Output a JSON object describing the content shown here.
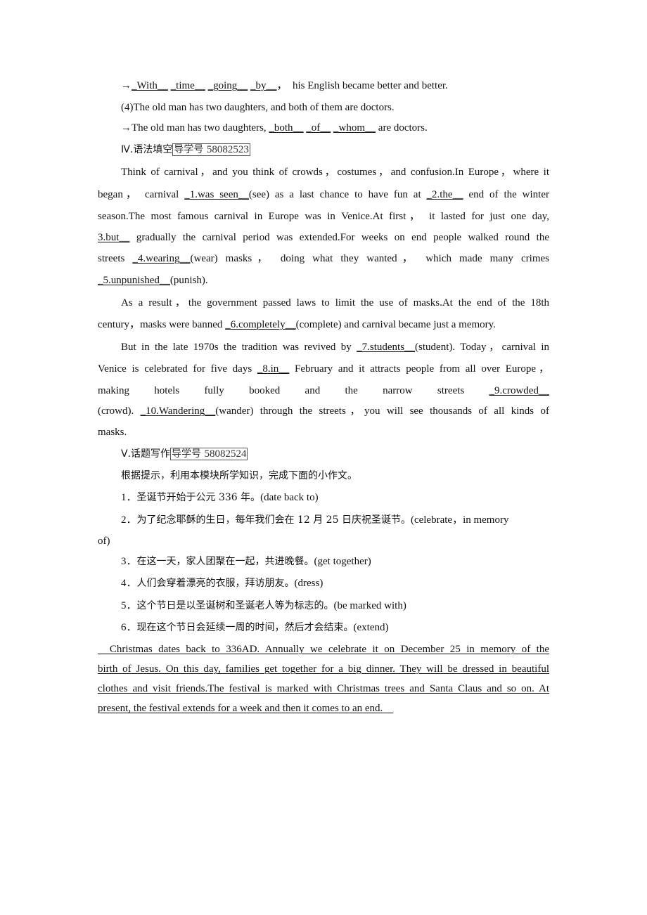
{
  "section3": {
    "line1": {
      "arrow": "→",
      "blanks": [
        "With",
        "time",
        "going",
        "by"
      ],
      "sep": "，",
      "rest": "his English became better and better."
    },
    "q4": "(4)The old man has two daughters, and both of them are doctors.",
    "line4": {
      "arrow": "→",
      "prefix": "The old man has two daughters,",
      "blanks": [
        "both",
        "of",
        "whom"
      ],
      "rest": "are doctors."
    }
  },
  "section4": {
    "heading": "Ⅳ.语法填空",
    "guide_label": "导学号",
    "guide_number": "58082523",
    "p1": {
      "l1": "Think of carnival，and you think of crowds，costumes，and confusion.In Europe，where it",
      "l2a": "began， carnival ",
      "b1": "1.was seen",
      "l2b": "(see) as a last chance to have fun at ",
      "b2": "2.the",
      "l2c": " end of the winter",
      "l3": "season.The most famous carnival in Europe was in Venice.At first， it lasted for just one day,",
      "b3": "3.but",
      "l4": " gradually the carnival period was extended.For weeks on end people walked round the",
      "l5a": "streets ",
      "b4": "4.wearing",
      "l5b": "(wear) masks， doing what they wanted， which made many crimes",
      "b5": "5.unpunished",
      "l6": "(punish)."
    },
    "p2": {
      "l1": "As a result，the government passed laws to limit the use of masks.At the end of the 18th",
      "l2a": "century，masks were banned ",
      "b6": "6.completely",
      "l2b": "(complete) and carnival became just a memory."
    },
    "p3": {
      "l1a": "But in the late 1970s the tradition was revived by ",
      "b7": "7.students",
      "l1b": "(student). Today，carnival in",
      "l2a": "Venice is celebrated for five days ",
      "b8": "8.in",
      "l2b": " February and it attracts people from all over Europe，",
      "l3words": [
        "making",
        "hotels",
        "fully",
        "booked",
        "and",
        "the",
        "narrow",
        "streets"
      ],
      "b9": "9.crowded",
      "l4a": "(crowd). ",
      "b10": "10.Wandering",
      "l4b": "(wander) through the streets，you will see thousands of all kinds of",
      "l5": "masks."
    }
  },
  "section5": {
    "heading": "Ⅴ.话题写作",
    "guide_label": "导学号",
    "guide_number": "58082524",
    "instruction": "根据提示，利用本模块所学知识，完成下面的小作文。",
    "items": [
      {
        "num": "1．",
        "cn": "圣诞节开始于公元 336 年。",
        "hint": "(date back to)"
      },
      {
        "num": "2．",
        "cn": "为了纪念耶稣的生日，每年我们会在 12 月 25 日庆祝圣诞节。",
        "hint": "(celebrate，in memory",
        "hint_cont": "of)"
      },
      {
        "num": "3．",
        "cn": "在这一天，家人团聚在一起，共进晚餐。",
        "hint": "(get together)"
      },
      {
        "num": "4．",
        "cn": "人们会穿着漂亮的衣服，拜访朋友。",
        "hint": "(dress)"
      },
      {
        "num": "5．",
        "cn": "这个节日是以圣诞树和圣诞老人等为标志的。",
        "hint": "(be marked with)"
      },
      {
        "num": "6．",
        "cn": "现在这个节日会延续一周的时间，然后才会结束。",
        "hint": "(extend)"
      }
    ],
    "answer_lines": [
      "  Christmas dates back to 336AD. Annually we celebrate it on December 25 in memory of the",
      "birth of Jesus. On this day, families get together for a big dinner. They will be dressed in beautiful",
      "clothes and visit friends.The festival is marked with Christmas trees and Santa Claus and so on. At",
      "present, the festival extends for a week and then it comes to an end.    "
    ]
  }
}
